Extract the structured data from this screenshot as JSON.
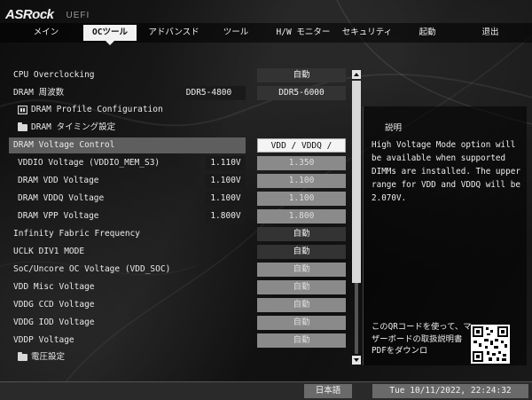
{
  "header": {
    "brand": "ASRock",
    "subtitle": "UEFI"
  },
  "nav": {
    "tabs": [
      {
        "label": "メイン"
      },
      {
        "label": "OCツール",
        "active": true
      },
      {
        "label": "アドバンスド"
      },
      {
        "label": "ツール"
      },
      {
        "label": "H/W モニター"
      },
      {
        "label": "セキュリティ"
      },
      {
        "label": "起動"
      },
      {
        "label": "退出"
      }
    ]
  },
  "settings": {
    "cpu_overclocking": {
      "label": "CPU Overclocking",
      "value": "自動"
    },
    "dram_frequency": {
      "label": "DRAM 周波数",
      "current": "DDR5-4800",
      "value": "DDR5-6000"
    },
    "dram_profile": {
      "label": "DRAM Profile Configuration"
    },
    "dram_timing": {
      "label": "DRAM タイミング設定"
    },
    "dram_voltage_control": {
      "label": "DRAM Voltage Control",
      "value": "VDD / VDDQ / VDDIO"
    },
    "vddio_voltage": {
      "label": "VDDIO Voltage (VDDIO_MEM_S3)",
      "current": "1.110V",
      "value": "1.350"
    },
    "dram_vdd_voltage": {
      "label": "DRAM VDD Voltage",
      "current": "1.100V",
      "value": "1.100"
    },
    "dram_vddq_voltage": {
      "label": "DRAM VDDQ Voltage",
      "current": "1.100V",
      "value": "1.100"
    },
    "dram_vpp_voltage": {
      "label": "DRAM VPP Voltage",
      "current": "1.800V",
      "value": "1.800"
    },
    "infinity_fabric": {
      "label": "Infinity Fabric Frequency",
      "value": "自動"
    },
    "uclk_div1": {
      "label": "UCLK DIV1 MODE",
      "value": "自動"
    },
    "soc_voltage": {
      "label": "SoC/Uncore OC Voltage (VDD_SOC)",
      "value": "自動"
    },
    "vdd_misc": {
      "label": "VDD Misc Voltage",
      "value": "自動"
    },
    "vddg_ccd": {
      "label": "VDDG CCD Voltage",
      "value": "自動"
    },
    "vddg_iod": {
      "label": "VDDG IOD Voltage",
      "value": "自動"
    },
    "vddp": {
      "label": "VDDP Voltage",
      "value": "自動"
    },
    "voltage_settings": {
      "label": "電圧設定"
    }
  },
  "description": {
    "title": "説明",
    "text": "High Voltage Mode option will be available when supported DIMMs are installed. The upper range for VDD and VDDQ will be 2.070V.",
    "qr_text": "このQRコードを使って、マザーボードの取扱説明書PDFをダウンロ"
  },
  "footer": {
    "language": "日本語",
    "datetime": "Tue 10/11/2022, 22:24:32"
  }
}
